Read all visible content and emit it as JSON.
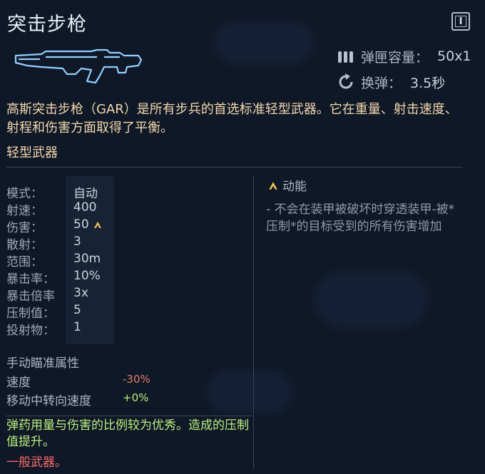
{
  "weapon": {
    "name": "突击步枪",
    "description": "高斯突击步枪（GAR）是所有步兵的首选标准轻型武器。它在重量、射击速度、射程和伤害方面取得了平衡。",
    "category": "轻型武器"
  },
  "header_stats": {
    "magazine_label": "弹匣容量：",
    "magazine_value": "50x1",
    "reload_label": "换弹：",
    "reload_value": "3.5秒"
  },
  "stats": [
    {
      "label": "模式：",
      "value": "自动"
    },
    {
      "label": "射速：",
      "value": "400"
    },
    {
      "label": "伤害：",
      "value": "50"
    },
    {
      "label": "散射：",
      "value": "3"
    },
    {
      "label": "范围：",
      "value": "30m"
    },
    {
      "label": "暴击率：",
      "value": "10%"
    },
    {
      "label": "暴击倍率",
      "value": "3x"
    },
    {
      "label": "压制值：",
      "value": "5"
    },
    {
      "label": "投射物：",
      "value": "1"
    }
  ],
  "kinetic": {
    "title": "动能",
    "description": "- 不会在装甲被破坏时穿透装甲-被*压制*的目标受到的所有伤害增加"
  },
  "aim": {
    "title": "手动瞄准属性",
    "rows": [
      {
        "label": "速度",
        "value": "-30%",
        "color": "#e07b6a"
      },
      {
        "label": "移动中转向速度",
        "value": "+0%",
        "color": "#b9f07c"
      }
    ]
  },
  "perks": {
    "good": "弹药用量与伤害的比例较为优秀。造成的压制值提升。",
    "bad": "一般武器。"
  },
  "icons": {
    "info": "I",
    "magazine": "ammo-icon",
    "reload": "reload-icon",
    "kinetic": "kinetic-chevron-icon",
    "weapon": "assault-rifle-icon"
  },
  "colors": {
    "background": "#0f1826",
    "description": "#f1d7ad",
    "positive": "#b9f07c",
    "negative": "#ff6a6a",
    "kinetic": "#f2c94c"
  }
}
